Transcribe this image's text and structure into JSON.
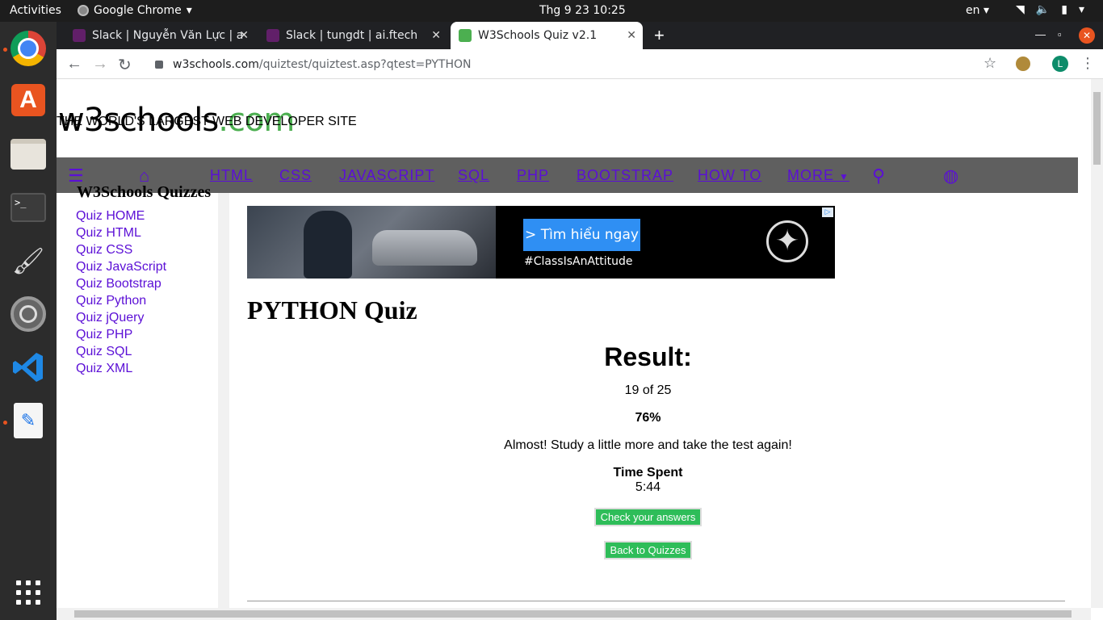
{
  "topbar": {
    "activities": "Activities",
    "app_name": "Google Chrome",
    "clock": "Thg 9 23  10:25",
    "language": "en"
  },
  "tabs": [
    {
      "title": "Slack | Nguyễn Văn Lực | a",
      "active": false
    },
    {
      "title": "Slack | tungdt | ai.ftech",
      "active": false
    },
    {
      "title": "W3Schools Quiz v2.1",
      "active": true
    }
  ],
  "toolbar": {
    "url_host": "w3schools.com",
    "url_path": "/quiztest/quiztest.asp?qtest=PYTHON",
    "profile_initial": "L"
  },
  "site": {
    "logo_main": "w3schools",
    "logo_tld": ".com",
    "tagline": "THE WORLD'S LARGEST WEB DEVELOPER SITE",
    "nav": [
      "HTML",
      "CSS",
      "JAVASCRIPT",
      "SQL",
      "PHP",
      "BOOTSTRAP",
      "HOW TO",
      "MORE"
    ]
  },
  "sidebar": {
    "title": "W3Schools Quizzes",
    "items": [
      "Quiz HOME",
      "Quiz HTML",
      "Quiz CSS",
      "Quiz JavaScript",
      "Quiz Bootstrap",
      "Quiz Python",
      "Quiz jQuery",
      "Quiz PHP",
      "Quiz SQL",
      "Quiz XML"
    ]
  },
  "ad": {
    "cta": "> Tìm hiểu ngay",
    "tag": "#ClassIsAnAttitude"
  },
  "quiz": {
    "title": "PYTHON Quiz",
    "result_title": "Result:",
    "score": "19 of 25",
    "percent": "76%",
    "message": "Almost! Study a little more and take the test again!",
    "time_label": "Time Spent",
    "time_value": "5:44",
    "check_answers": "Check your answers",
    "back": "Back to Quizzes"
  },
  "colors": {
    "link": "#5b0fd6",
    "button": "#2ebd59",
    "nav_bg": "#5f5f5f",
    "brand_green": "#4caf50"
  }
}
